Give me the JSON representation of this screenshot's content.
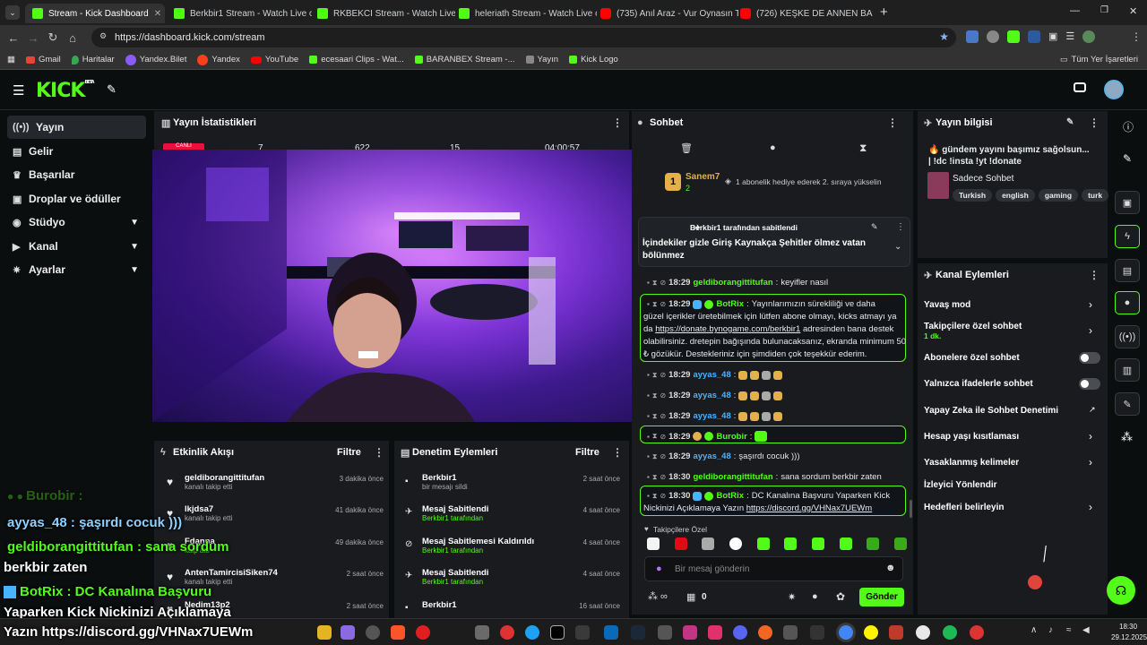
{
  "tabs": [
    {
      "title": "Stream - Kick Dashboard",
      "icon": "kick",
      "active": true
    },
    {
      "title": "Berkbir1 Stream - Watch Live o",
      "icon": "kick"
    },
    {
      "title": "RKBEKCI Stream - Watch Live o",
      "icon": "kick"
    },
    {
      "title": "heleriath Stream - Watch Live o",
      "icon": "kick"
    },
    {
      "title": "(735) Anıl Araz - Vur Oynasın Tı",
      "icon": "youtube"
    },
    {
      "title": "(726) KEŞKE DE ANNEN BA",
      "icon": "youtube"
    }
  ],
  "url": "https://dashboard.kick.com/stream",
  "bookmarks": [
    "Gmail",
    "Haritalar",
    "Yandex.Bilet",
    "Yandex",
    "YouTube",
    "ecesaari Clips - Wat...",
    "BARANBEX Stream -...",
    "Yayın",
    "Kick Logo"
  ],
  "bookmarks_all": "Tüm Yer İşaretleri",
  "logo": "KICK",
  "logo_beta": "BETA",
  "sidebar": [
    {
      "label": "Yayın",
      "icon": "live-icon",
      "active": true
    },
    {
      "label": "Gelir",
      "icon": "revenue-icon"
    },
    {
      "label": "Başarılar",
      "icon": "trophy-icon"
    },
    {
      "label": "Droplar ve ödüller",
      "icon": "gift-icon"
    },
    {
      "label": "Stüdyo",
      "icon": "studio-icon",
      "expand": true
    },
    {
      "label": "Kanal",
      "icon": "channel-icon",
      "expand": true
    },
    {
      "label": "Ayarlar",
      "icon": "settings-icon",
      "expand": true
    }
  ],
  "stats": {
    "title": "Yayın İstatistikleri",
    "live": "CANLI",
    "viewers": "7",
    "followers": "622",
    "subs": "15",
    "duration": "04:00:57"
  },
  "chat": {
    "title": "Sohbet",
    "gift_user": "Sanem7",
    "gift_count": "2",
    "gift_rank": "1",
    "gift_text": "1 abonelik hediye ederek 2. sıraya yükselin",
    "pinned_by": "Berkbir1 tarafından sabitlendi",
    "pinned_text": "İçindekiler gizle Giriş Kaynakça Şehitler ölmez vatan bölünmez",
    "messages": [
      {
        "time": "18:29",
        "user": "geldiborangittitufan",
        "text": "keyifler nasıl",
        "color": "g"
      },
      {
        "time": "18:29",
        "user": "BotRix",
        "text": "Yayınlarımızın sürekliliği ve daha güzel içerikler üretebilmek için lütfen abone olmayı, kicks atmayı ya da https://donate.bynogame.com/berkbir1 adresinden bana destek olabilirsiniz. dretepin bağışında bulunacaksanız, ekranda minimum 50 ₺ gözükür. Destekleriniz için şimdiden çok teşekkür ederim.",
        "color": "g",
        "box": true
      },
      {
        "time": "18:29",
        "user": "ayyas_48",
        "text": "",
        "color": "b"
      },
      {
        "time": "18:29",
        "user": "ayyas_48",
        "text": "",
        "color": "b"
      },
      {
        "time": "18:29",
        "user": "ayyas_48",
        "text": "",
        "color": "b"
      },
      {
        "time": "18:29",
        "user": "Burobir",
        "text": "",
        "color": "g",
        "box": true
      },
      {
        "time": "18:29",
        "user": "ayyas_48",
        "text": "şaşırdı cocuk )))",
        "color": "b"
      },
      {
        "time": "18:30",
        "user": "geldiborangittitufan",
        "text": "sana sordum berkbir zaten",
        "color": "g"
      },
      {
        "time": "18:30",
        "user": "BotRix",
        "text": "DC Kanalına Başvuru Yaparken Kick Nickinizi Açıklamaya Yazın https://discord.gg/VHNax7UEWm",
        "color": "g",
        "box": true
      }
    ],
    "botrix_line1": "Yayınlarımızın sürekliliği ve daha",
    "botrix_line2": "güzel içerikler üretebilmek için lütfen abone olmayı, kicks atmayı ya",
    "botrix_line3_a": "da ",
    "botrix_line3_link": "https://donate.bynogame.com/berkbir1",
    "botrix_line3_b": " adresinden bana destek",
    "botrix_line4": "olabilirsiniz. dretepin bağışında bulunacaksanız, ekranda minimum 50",
    "botrix_line5": "₺ gözükür. Destekleriniz için şimdiden çok teşekkür ederim.",
    "botrix2_line1": "DC Kanalına Başvuru Yaparken Kick",
    "botrix2_line2": "Nickinizi Açıklamaya Yazın ",
    "botrix2_link": "https://discord.gg/VHNax7UEWm",
    "followers_only": "Takipçilere Özel",
    "placeholder": "Bir mesaj gönderin",
    "points": "0",
    "send": "Gönder"
  },
  "stream_info": {
    "title": "Yayın bilgisi",
    "stream_title": "🔥 gündem yayını başımız sağolsun... | !dc !insta !yt !donate",
    "category": "Sadece Sohbet",
    "tags": [
      "Turkish",
      "english",
      "gaming",
      "turk"
    ]
  },
  "channel_actions": {
    "title": "Kanal Eylemleri",
    "items": [
      {
        "label": "Yavaş mod",
        "kind": "chevron"
      },
      {
        "label": "Takipçilere özel sohbet",
        "sub": "1 dk.",
        "kind": "chevron"
      },
      {
        "label": "Abonelere özel sohbet",
        "kind": "toggle"
      },
      {
        "label": "Yalnızca ifadelerle sohbet",
        "kind": "toggle"
      },
      {
        "label": "Yapay Zeka ile Sohbet Denetimi",
        "kind": "external"
      },
      {
        "label": "Hesap yaşı kısıtlaması",
        "kind": "chevron"
      },
      {
        "label": "Yasaklanmış kelimeler",
        "kind": "chevron"
      },
      {
        "label": "İzleyici Yönlendir",
        "kind": "none"
      },
      {
        "label": "Hedefleri belirleyin",
        "kind": "chevron"
      }
    ]
  },
  "activity": {
    "title": "Etkinlik Akışı",
    "filter": "Filtre",
    "items": [
      {
        "name": "geldiborangittitufan",
        "sub": "kanalı takip etti",
        "time": "3 dakika önce"
      },
      {
        "name": "lkjdsa7",
        "sub": "kanalı takip etti",
        "time": "41 dakika önce"
      },
      {
        "name": "Fdanna",
        "sub": "kalp attı",
        "time": "49 dakika önce"
      },
      {
        "name": "AntenTamircisiSiken74",
        "sub": "kanalı takip etti",
        "time": "2 saat önce"
      },
      {
        "name": "Nedim13p2",
        "sub": "",
        "time": "2 saat önce"
      }
    ]
  },
  "moderation": {
    "title": "Denetim Eylemleri",
    "filter": "Filtre",
    "items": [
      {
        "name": "Berkbir1",
        "sub": "bir mesajı sildi",
        "time": "2 saat önce",
        "green": false
      },
      {
        "name": "Mesaj Sabitlendi",
        "sub": "Berkbir1 tarafından",
        "time": "4 saat önce",
        "green": true
      },
      {
        "name": "Mesaj Sabitlemesi Kaldırıldı",
        "sub": "Berkbir1 tarafından",
        "time": "4 saat önce",
        "green": true
      },
      {
        "name": "Mesaj Sabitlendi",
        "sub": "Berkbir1 tarafından",
        "time": "4 saat önce",
        "green": true
      },
      {
        "name": "Berkbir1",
        "sub": "",
        "time": "16 saat önce",
        "green": false
      }
    ]
  },
  "overlay": {
    "line0": "Burobir :",
    "line1": "ayyas_48 : şaşırdı cocuk )))",
    "line2": "geldiborangittitufan : sana sordum",
    "line3": "berkbir zaten",
    "line4": "BotRix : DC Kanalına Başvuru",
    "line5": "Yaparken Kick Nickinizi Açıklamaya",
    "line6": "Yazın https://discord.gg/VHNax7UEWm"
  },
  "taskbar": {
    "time": "18:30",
    "date": "29.12.2025"
  },
  "colors": {
    "kick_green": "#53fc18",
    "panel": "#191b1f",
    "bg": "#0b0e0f",
    "accent_red": "#e9113c"
  }
}
